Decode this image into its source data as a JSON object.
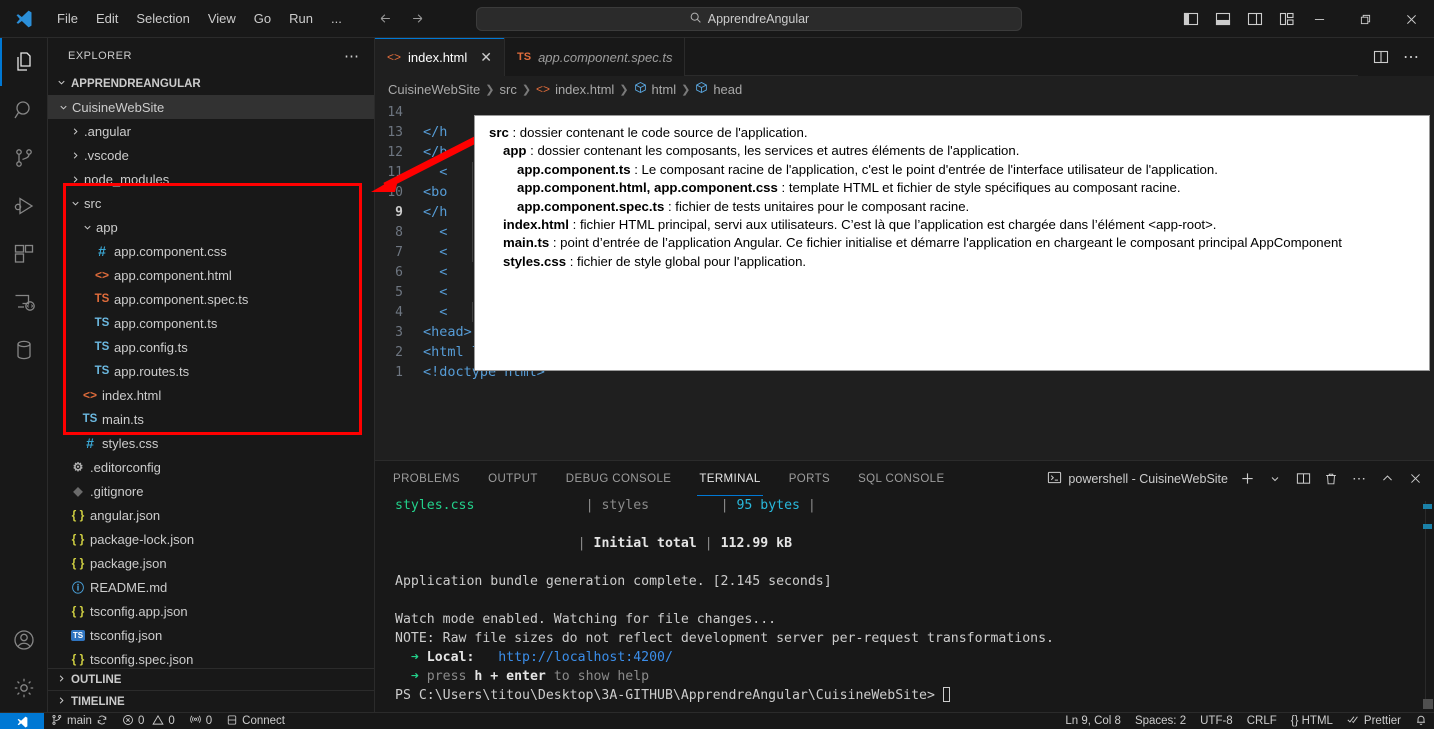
{
  "titlebar": {
    "menu": [
      "File",
      "Edit",
      "Selection",
      "View",
      "Go",
      "Run",
      "..."
    ],
    "search_value": "ApprendreAngular",
    "back_icon": "arrow-left-icon",
    "forward_icon": "arrow-right-icon",
    "layout_icons": [
      "toggle-primary-sidebar-icon",
      "toggle-panel-icon",
      "toggle-secondary-sidebar-icon",
      "customize-layout-icon"
    ],
    "window": {
      "minimize": "—",
      "restore": "❐",
      "close": "✕"
    }
  },
  "activitybar": {
    "items": [
      {
        "name": "explorer",
        "icon": "files-icon",
        "active": true
      },
      {
        "name": "search",
        "icon": "search-icon",
        "active": false
      },
      {
        "name": "source-control",
        "icon": "source-control-icon",
        "active": false
      },
      {
        "name": "run-and-debug",
        "icon": "run-debug-icon",
        "active": false
      },
      {
        "name": "extensions",
        "icon": "extensions-icon",
        "active": false
      },
      {
        "name": "remote-explorer",
        "icon": "remote-explorer-icon",
        "active": false
      },
      {
        "name": "database",
        "icon": "database-icon",
        "active": false
      }
    ],
    "bottom": [
      {
        "name": "accounts",
        "icon": "account-icon"
      },
      {
        "name": "manage",
        "icon": "gear-icon"
      }
    ]
  },
  "sidebar": {
    "title": "EXPLORER",
    "more_actions": "⋯",
    "root_label": "APPRENDREANGULAR",
    "tree": [
      {
        "label": "CuisineWebSite",
        "type": "folder",
        "expanded": true,
        "indent": 0,
        "selected": true
      },
      {
        "label": ".angular",
        "type": "folder",
        "expanded": false,
        "indent": 1
      },
      {
        "label": ".vscode",
        "type": "folder",
        "expanded": false,
        "indent": 1
      },
      {
        "label": "node_modules",
        "type": "folder",
        "expanded": false,
        "indent": 1
      },
      {
        "label": "src",
        "type": "folder",
        "expanded": true,
        "indent": 1
      },
      {
        "label": "app",
        "type": "folder",
        "expanded": true,
        "indent": 2
      },
      {
        "label": "app.component.css",
        "type": "css",
        "indent": 3
      },
      {
        "label": "app.component.html",
        "type": "html",
        "indent": 3
      },
      {
        "label": "app.component.spec.ts",
        "type": "ts-orange",
        "indent": 3
      },
      {
        "label": "app.component.ts",
        "type": "ts",
        "indent": 3
      },
      {
        "label": "app.config.ts",
        "type": "ts",
        "indent": 3
      },
      {
        "label": "app.routes.ts",
        "type": "ts",
        "indent": 3
      },
      {
        "label": "index.html",
        "type": "html",
        "indent": 2
      },
      {
        "label": "main.ts",
        "type": "ts",
        "indent": 2
      },
      {
        "label": "styles.css",
        "type": "css",
        "indent": 2
      },
      {
        "label": ".editorconfig",
        "type": "gear",
        "indent": 1
      },
      {
        "label": ".gitignore",
        "type": "git",
        "indent": 1
      },
      {
        "label": "angular.json",
        "type": "json",
        "indent": 1
      },
      {
        "label": "package-lock.json",
        "type": "json",
        "indent": 1
      },
      {
        "label": "package.json",
        "type": "json",
        "indent": 1
      },
      {
        "label": "README.md",
        "type": "md",
        "indent": 1
      },
      {
        "label": "tsconfig.app.json",
        "type": "json",
        "indent": 1
      },
      {
        "label": "tsconfig.json",
        "type": "tsjson",
        "indent": 1
      },
      {
        "label": "tsconfig.spec.json",
        "type": "json",
        "indent": 1
      }
    ],
    "sections": [
      "OUTLINE",
      "TIMELINE"
    ]
  },
  "editor": {
    "tabs": [
      {
        "label": "index.html",
        "icon": "html-icon",
        "active": true,
        "closable": true,
        "italic": false
      },
      {
        "label": "app.component.spec.ts",
        "icon": "ts-icon",
        "active": false,
        "closable": false,
        "italic": true
      }
    ],
    "tab_actions": [
      "split-editor-icon",
      "more-actions-icon"
    ],
    "breadcrumb": [
      "CuisineWebSite",
      "src",
      "index.html",
      "html",
      "head"
    ],
    "lines": [
      {
        "n": "1",
        "text": "<!doctype html>"
      },
      {
        "n": "2",
        "text": "<html lang=\"en\">"
      },
      {
        "n": "3",
        "text": "<head>"
      },
      {
        "n": "4",
        "text": "  <"
      },
      {
        "n": "5",
        "text": "  <"
      },
      {
        "n": "6",
        "text": "  <"
      },
      {
        "n": "7",
        "text": "  <"
      },
      {
        "n": "8",
        "text": "  <"
      },
      {
        "n": "9",
        "text": "</h",
        "current": true
      },
      {
        "n": "10",
        "text": "<bo"
      },
      {
        "n": "11",
        "text": "  <"
      },
      {
        "n": "12",
        "text": "</b"
      },
      {
        "n": "13",
        "text": "</h"
      },
      {
        "n": "14",
        "text": ""
      }
    ]
  },
  "tooltip": [
    {
      "indent": 0,
      "bold": "src",
      "rest": " : dossier contenant le code source de l'application."
    },
    {
      "indent": 1,
      "bold": "app",
      "rest": " : dossier contenant les composants, les services et autres éléments de l'application."
    },
    {
      "indent": 2,
      "bold": "app.component.ts",
      "rest": " : Le composant racine de l'application, c'est le point d'entrée de l'interface utilisateur de l'application."
    },
    {
      "indent": 2,
      "bold": "app.component.html, app.component.css",
      "rest": " : template HTML et fichier de style spécifiques au composant racine."
    },
    {
      "indent": 2,
      "bold": "app.component.spec.ts",
      "rest": " : fichier de tests unitaires pour le composant racine."
    },
    {
      "indent": 1,
      "bold": "index.html",
      "rest": " : fichier HTML principal, servi aux utilisateurs. C’est là que l’application est chargée dans l’élément <app-root>."
    },
    {
      "indent": 1,
      "bold": "main.ts",
      "rest": " : point d’entrée de l’application Angular. Ce fichier initialise et démarre l'application en chargeant le composant   principal AppComponent"
    },
    {
      "indent": 1,
      "bold": "styles.css",
      "rest": " : fichier de style global pour l'application."
    }
  ],
  "panel": {
    "tabs": [
      {
        "label": "PROBLEMS",
        "active": false
      },
      {
        "label": "OUTPUT",
        "active": false
      },
      {
        "label": "DEBUG CONSOLE",
        "active": false
      },
      {
        "label": "TERMINAL",
        "active": true
      },
      {
        "label": "PORTS",
        "active": false
      },
      {
        "label": "SQL CONSOLE",
        "active": false
      }
    ],
    "terminal_name": "powershell - CuisineWebSite",
    "terminal_icon": "terminal-powershell-icon",
    "actions": [
      "new-terminal-icon",
      "chevron-down-icon",
      "split-terminal-icon",
      "kill-terminal-icon",
      "more-actions-icon",
      "maximize-panel-icon",
      "close-panel-icon"
    ]
  },
  "terminal": {
    "lines": [
      {
        "segs": [
          {
            "t": "styles.css",
            "c": "t-green"
          },
          {
            "t": "              ",
            "c": ""
          },
          {
            "t": "| ",
            "c": "t-gray"
          },
          {
            "t": "styles",
            "c": "t-gray"
          },
          {
            "t": "         ",
            "c": ""
          },
          {
            "t": "| ",
            "c": "t-gray"
          },
          {
            "t": "95 bytes",
            "c": "t-cyan"
          },
          {
            "t": " |",
            "c": "t-gray"
          }
        ]
      },
      {
        "segs": []
      },
      {
        "segs": [
          {
            "t": "                       ",
            "c": ""
          },
          {
            "t": "| ",
            "c": "t-gray"
          },
          {
            "t": "Initial total",
            "c": "t-white-b"
          },
          {
            "t": " | ",
            "c": "t-gray"
          },
          {
            "t": "112.99 kB",
            "c": "t-white-b"
          }
        ]
      },
      {
        "segs": []
      },
      {
        "segs": [
          {
            "t": "Application bundle generation complete. [2.145 seconds]",
            "c": ""
          }
        ]
      },
      {
        "segs": []
      },
      {
        "segs": [
          {
            "t": "Watch mode enabled. Watching for file changes...",
            "c": ""
          }
        ]
      },
      {
        "segs": [
          {
            "t": "NOTE: Raw file sizes do not reflect development server per-request transformations.",
            "c": ""
          }
        ]
      },
      {
        "segs": [
          {
            "t": "  ➜ ",
            "c": "t-green"
          },
          {
            "t": "Local:",
            "c": "t-white-b"
          },
          {
            "t": "   ",
            "c": ""
          },
          {
            "t": "http://localhost:4200/",
            "c": "t-blue"
          }
        ]
      },
      {
        "segs": [
          {
            "t": "  ➜ ",
            "c": "t-green"
          },
          {
            "t": "press ",
            "c": "t-gray"
          },
          {
            "t": "h + enter",
            "c": "t-white-b"
          },
          {
            "t": " to show help",
            "c": "t-gray"
          }
        ]
      },
      {
        "segs": [
          {
            "t": "PS C:\\Users\\titou\\Desktop\\3A-GITHUB\\ApprendreAngular\\CuisineWebSite> ",
            "c": ""
          }
        ],
        "cursor": true
      }
    ]
  },
  "statusbar": {
    "left": [
      {
        "icon": "remote-window-icon",
        "label": ""
      },
      {
        "icon": "source-control-branch-icon",
        "label": "main"
      },
      {
        "icon": "sync-icon",
        "label": ""
      },
      {
        "icon": "error-icon",
        "label": "0"
      },
      {
        "icon": "warning-icon",
        "label": "0"
      },
      {
        "icon": "radio-tower-icon",
        "label": "0"
      },
      {
        "icon": "database-connect-icon",
        "label": "Connect"
      }
    ],
    "right": [
      {
        "label": "Ln 9, Col 8"
      },
      {
        "label": "Spaces: 2"
      },
      {
        "label": "UTF-8"
      },
      {
        "label": "CRLF"
      },
      {
        "label": "{} HTML"
      },
      {
        "label": "Prettier",
        "icon": "check-check-icon"
      },
      {
        "label": "",
        "icon": "bell-icon"
      }
    ]
  },
  "colors": {
    "accent": "#0078d4",
    "annotation_red": "#ff0000",
    "terminal_green": "#23d18b",
    "terminal_cyan": "#29b8db",
    "link_blue": "#3b8eea"
  }
}
